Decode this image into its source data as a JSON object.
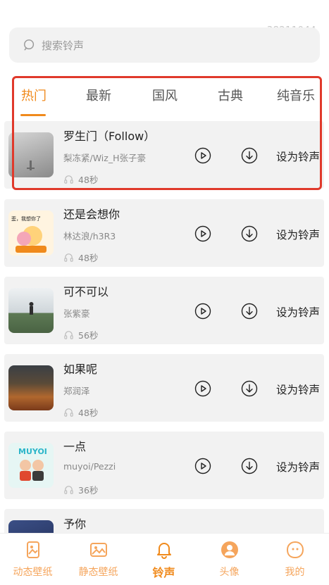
{
  "watermark": "38211044",
  "search": {
    "placeholder": "搜索铃声"
  },
  "tabs": [
    {
      "label": "热门",
      "active": true
    },
    {
      "label": "最新",
      "active": false
    },
    {
      "label": "国风",
      "active": false
    },
    {
      "label": "古典",
      "active": false
    },
    {
      "label": "纯音乐",
      "active": false
    }
  ],
  "songs": [
    {
      "title": "罗生门（Follow）",
      "artist": "梨冻紧/Wiz_H张子豪",
      "duration": "48秒",
      "action": "设为铃声"
    },
    {
      "title": "还是会想你",
      "artist": "林达浪/h3R3",
      "duration": "48秒",
      "action": "设为铃声",
      "cover_text": "歪，我想你了"
    },
    {
      "title": "可不可以",
      "artist": "张紫豪",
      "duration": "56秒",
      "action": "设为铃声"
    },
    {
      "title": "如果呢",
      "artist": "郑润泽",
      "duration": "48秒",
      "action": "设为铃声"
    },
    {
      "title": "一点",
      "artist": "muyoi/Pezzi",
      "duration": "36秒",
      "action": "设为铃声",
      "cover_text": "MUYOI"
    },
    {
      "title": "予你",
      "artist": "",
      "duration": "",
      "action": ""
    }
  ],
  "bottom_nav": [
    {
      "label": "动态壁纸",
      "icon": "live-wallpaper-icon",
      "active": false
    },
    {
      "label": "静态壁纸",
      "icon": "image-icon",
      "active": false
    },
    {
      "label": "铃声",
      "icon": "bell-icon",
      "active": true
    },
    {
      "label": "头像",
      "icon": "avatar-icon",
      "active": false
    },
    {
      "label": "我的",
      "icon": "profile-icon",
      "active": false
    }
  ],
  "colors": {
    "accent": "#f08a1c",
    "nav_inactive": "#f5a55c",
    "highlight": "#e0392b",
    "card": "#f2f2f2"
  }
}
